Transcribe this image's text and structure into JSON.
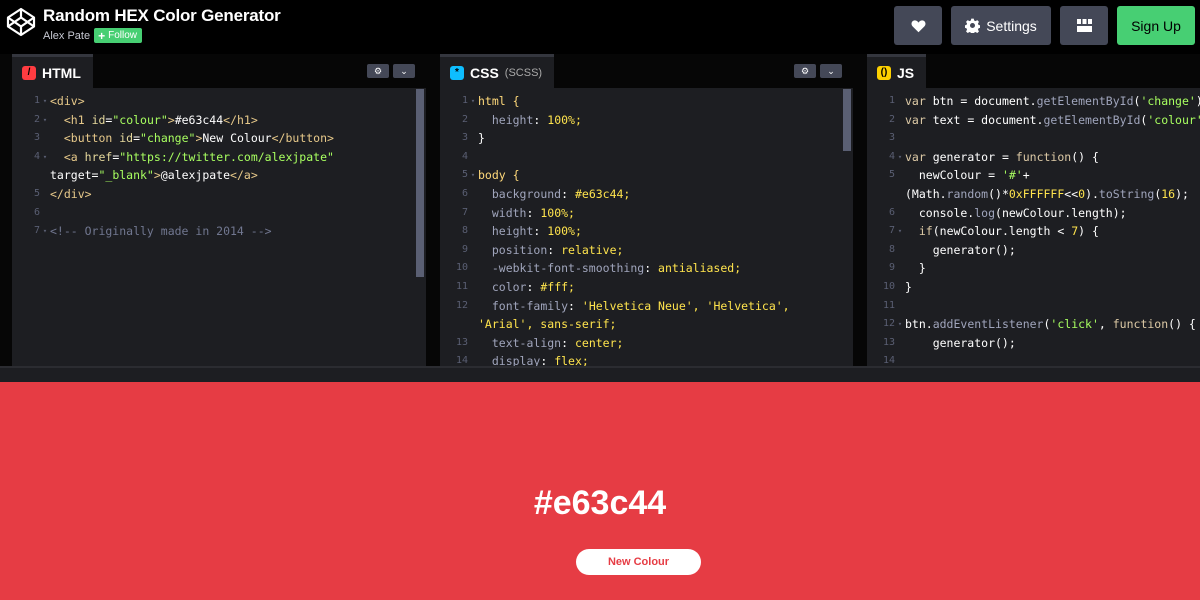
{
  "header": {
    "title": "Random HEX Color Generator",
    "author": "Alex Pate",
    "follow_label": "Follow",
    "settings_label": "Settings",
    "signup_label": "Sign Up"
  },
  "panels": {
    "html": {
      "name": "HTML",
      "badge": "/"
    },
    "css": {
      "name": "CSS",
      "sub": "(SCSS)",
      "badge": "*"
    },
    "js": {
      "name": "JS",
      "badge": "()"
    }
  },
  "html_lines": [
    "<div>",
    "  <h1 id=\"colour\">#e63c44</h1>",
    "  <button id=\"change\">New Colour</button>",
    "  <a href=\"https://twitter.com/alexjpate\"",
    "target=\"_blank\">@alexjpate</a>",
    "</div>",
    "",
    "<!-- Originally made in 2014 -->"
  ],
  "css_lines": [
    "html {",
    "  height: 100%;",
    "}",
    "",
    "body {",
    "  background: #e63c44;",
    "  width: 100%;",
    "  height: 100%;",
    "  position: relative;",
    "  -webkit-font-smoothing: antialiased;",
    "  color: #fff;",
    "  font-family: 'Helvetica Neue', 'Helvetica',",
    "'Arial', sans-serif;",
    "  text-align: center;",
    "  display: flex;"
  ],
  "js_lines": [
    "var btn = document.getElementById('change');",
    "var text = document.getElementById('colour');",
    "",
    "var generator = function() {",
    "  newColour = '#'+",
    "(Math.random()*0xFFFFFF<<0).toString(16);",
    "  console.log(newColour.length);",
    "  if(newColour.length < 7) {",
    "    generator();",
    "  }",
    "}",
    "",
    "btn.addEventListener('click', function() {",
    "    generator();",
    ""
  ],
  "preview": {
    "colour_text": "#e63c44",
    "button_label": "New Colour",
    "background": "#e63c44"
  },
  "colors": {
    "accent_green": "#47cf73",
    "button_gray": "#444857",
    "editor_bg": "#1d1e22"
  }
}
